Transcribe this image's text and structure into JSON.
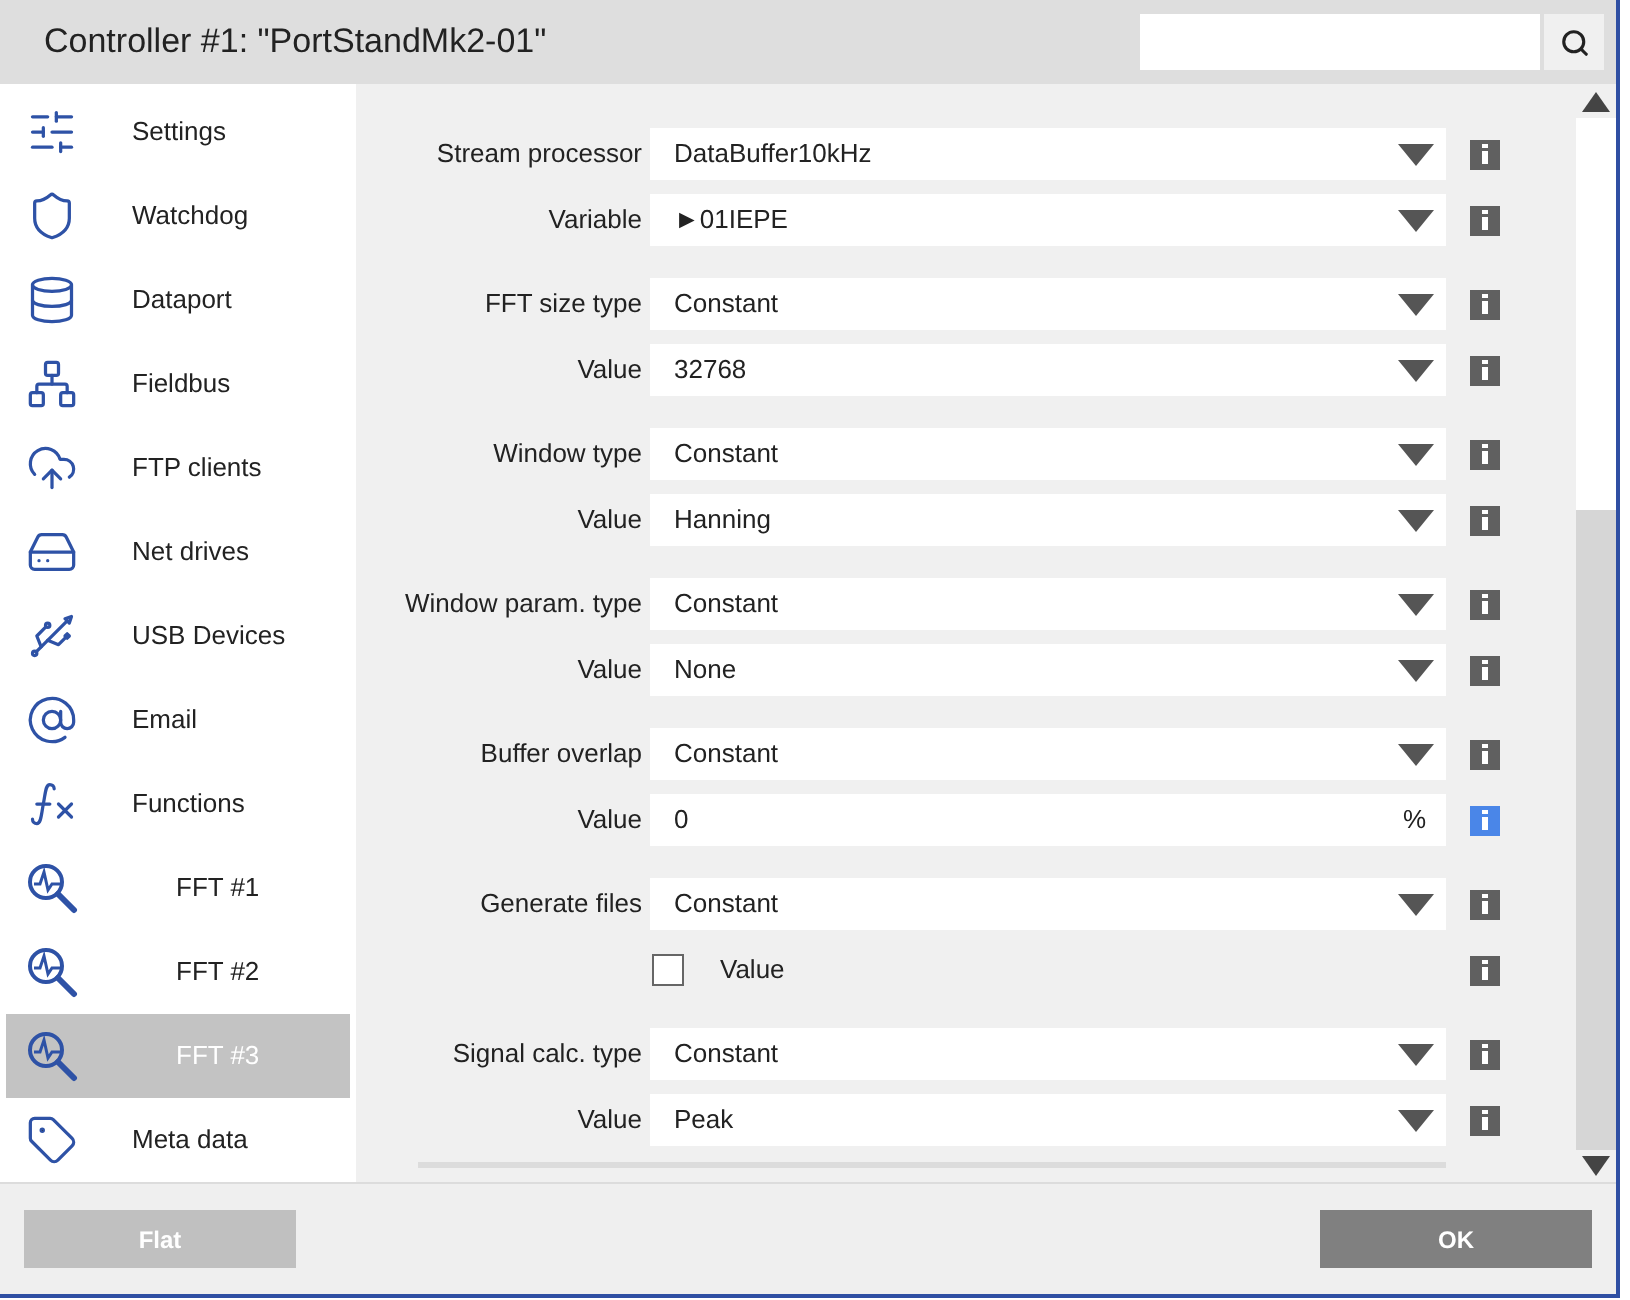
{
  "window": {
    "title": "Controller #1: \"PortStandMk2-01\""
  },
  "sidebar": {
    "items": [
      {
        "label": "Settings",
        "selected": false
      },
      {
        "label": "Watchdog",
        "selected": false
      },
      {
        "label": "Dataport",
        "selected": false
      },
      {
        "label": "Fieldbus",
        "selected": false
      },
      {
        "label": "FTP clients",
        "selected": false
      },
      {
        "label": "Net drives",
        "selected": false
      },
      {
        "label": "USB Devices",
        "selected": false
      },
      {
        "label": "Email",
        "selected": false
      },
      {
        "label": "Functions",
        "selected": false,
        "children": [
          {
            "label": "FFT #1",
            "selected": false
          },
          {
            "label": "FFT #2",
            "selected": false
          },
          {
            "label": "FFT #3",
            "selected": true
          }
        ]
      },
      {
        "label": "Meta data",
        "selected": false
      }
    ]
  },
  "form": {
    "groups": [
      {
        "rows": [
          {
            "kind": "select",
            "label": "Stream processor",
            "value": "DataBuffer10kHz",
            "info_highlighted": false
          },
          {
            "kind": "select",
            "label": "Variable",
            "value": "►01IEPE",
            "info_highlighted": false
          }
        ]
      },
      {
        "rows": [
          {
            "kind": "select",
            "label": "FFT size type",
            "value": "Constant",
            "info_highlighted": false
          },
          {
            "kind": "select",
            "label": "Value",
            "value": "32768",
            "info_highlighted": false
          }
        ]
      },
      {
        "rows": [
          {
            "kind": "select",
            "label": "Window type",
            "value": "Constant",
            "info_highlighted": false
          },
          {
            "kind": "select",
            "label": "Value",
            "value": "Hanning",
            "info_highlighted": false
          }
        ]
      },
      {
        "rows": [
          {
            "kind": "select",
            "label": "Window param. type",
            "value": "Constant",
            "info_highlighted": false
          },
          {
            "kind": "select",
            "label": "Value",
            "value": "None",
            "info_highlighted": false
          }
        ]
      },
      {
        "rows": [
          {
            "kind": "select",
            "label": "Buffer overlap",
            "value": "Constant",
            "info_highlighted": false
          },
          {
            "kind": "input",
            "label": "Value",
            "value": "0",
            "unit": "%",
            "info_highlighted": true
          }
        ]
      },
      {
        "rows": [
          {
            "kind": "select",
            "label": "Generate files",
            "value": "Constant",
            "info_highlighted": false
          },
          {
            "kind": "checkbox",
            "label": "Value",
            "checked": false,
            "info_highlighted": false
          }
        ]
      },
      {
        "rows": [
          {
            "kind": "select",
            "label": "Signal calc. type",
            "value": "Constant",
            "info_highlighted": false
          },
          {
            "kind": "select",
            "label": "Value",
            "value": "Peak",
            "info_highlighted": false
          }
        ]
      }
    ]
  },
  "footer": {
    "buttons": [
      {
        "label": "Flat",
        "disabled": true
      },
      {
        "label": "OK",
        "disabled": false
      }
    ]
  }
}
